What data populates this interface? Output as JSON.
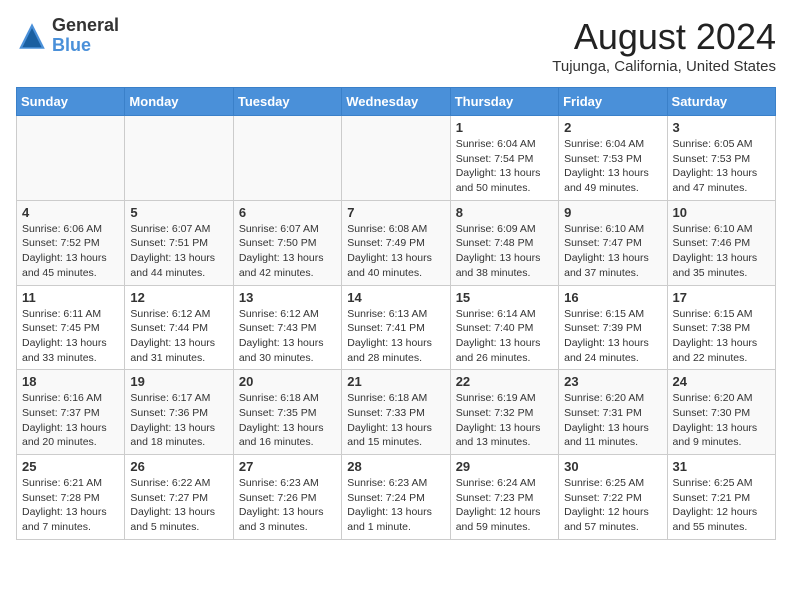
{
  "header": {
    "logo_general": "General",
    "logo_blue": "Blue",
    "month_title": "August 2024",
    "location": "Tujunga, California, United States"
  },
  "days_of_week": [
    "Sunday",
    "Monday",
    "Tuesday",
    "Wednesday",
    "Thursday",
    "Friday",
    "Saturday"
  ],
  "weeks": [
    [
      {
        "day": "",
        "info": ""
      },
      {
        "day": "",
        "info": ""
      },
      {
        "day": "",
        "info": ""
      },
      {
        "day": "",
        "info": ""
      },
      {
        "day": "1",
        "info": "Sunrise: 6:04 AM\nSunset: 7:54 PM\nDaylight: 13 hours\nand 50 minutes."
      },
      {
        "day": "2",
        "info": "Sunrise: 6:04 AM\nSunset: 7:53 PM\nDaylight: 13 hours\nand 49 minutes."
      },
      {
        "day": "3",
        "info": "Sunrise: 6:05 AM\nSunset: 7:53 PM\nDaylight: 13 hours\nand 47 minutes."
      }
    ],
    [
      {
        "day": "4",
        "info": "Sunrise: 6:06 AM\nSunset: 7:52 PM\nDaylight: 13 hours\nand 45 minutes."
      },
      {
        "day": "5",
        "info": "Sunrise: 6:07 AM\nSunset: 7:51 PM\nDaylight: 13 hours\nand 44 minutes."
      },
      {
        "day": "6",
        "info": "Sunrise: 6:07 AM\nSunset: 7:50 PM\nDaylight: 13 hours\nand 42 minutes."
      },
      {
        "day": "7",
        "info": "Sunrise: 6:08 AM\nSunset: 7:49 PM\nDaylight: 13 hours\nand 40 minutes."
      },
      {
        "day": "8",
        "info": "Sunrise: 6:09 AM\nSunset: 7:48 PM\nDaylight: 13 hours\nand 38 minutes."
      },
      {
        "day": "9",
        "info": "Sunrise: 6:10 AM\nSunset: 7:47 PM\nDaylight: 13 hours\nand 37 minutes."
      },
      {
        "day": "10",
        "info": "Sunrise: 6:10 AM\nSunset: 7:46 PM\nDaylight: 13 hours\nand 35 minutes."
      }
    ],
    [
      {
        "day": "11",
        "info": "Sunrise: 6:11 AM\nSunset: 7:45 PM\nDaylight: 13 hours\nand 33 minutes."
      },
      {
        "day": "12",
        "info": "Sunrise: 6:12 AM\nSunset: 7:44 PM\nDaylight: 13 hours\nand 31 minutes."
      },
      {
        "day": "13",
        "info": "Sunrise: 6:12 AM\nSunset: 7:43 PM\nDaylight: 13 hours\nand 30 minutes."
      },
      {
        "day": "14",
        "info": "Sunrise: 6:13 AM\nSunset: 7:41 PM\nDaylight: 13 hours\nand 28 minutes."
      },
      {
        "day": "15",
        "info": "Sunrise: 6:14 AM\nSunset: 7:40 PM\nDaylight: 13 hours\nand 26 minutes."
      },
      {
        "day": "16",
        "info": "Sunrise: 6:15 AM\nSunset: 7:39 PM\nDaylight: 13 hours\nand 24 minutes."
      },
      {
        "day": "17",
        "info": "Sunrise: 6:15 AM\nSunset: 7:38 PM\nDaylight: 13 hours\nand 22 minutes."
      }
    ],
    [
      {
        "day": "18",
        "info": "Sunrise: 6:16 AM\nSunset: 7:37 PM\nDaylight: 13 hours\nand 20 minutes."
      },
      {
        "day": "19",
        "info": "Sunrise: 6:17 AM\nSunset: 7:36 PM\nDaylight: 13 hours\nand 18 minutes."
      },
      {
        "day": "20",
        "info": "Sunrise: 6:18 AM\nSunset: 7:35 PM\nDaylight: 13 hours\nand 16 minutes."
      },
      {
        "day": "21",
        "info": "Sunrise: 6:18 AM\nSunset: 7:33 PM\nDaylight: 13 hours\nand 15 minutes."
      },
      {
        "day": "22",
        "info": "Sunrise: 6:19 AM\nSunset: 7:32 PM\nDaylight: 13 hours\nand 13 minutes."
      },
      {
        "day": "23",
        "info": "Sunrise: 6:20 AM\nSunset: 7:31 PM\nDaylight: 13 hours\nand 11 minutes."
      },
      {
        "day": "24",
        "info": "Sunrise: 6:20 AM\nSunset: 7:30 PM\nDaylight: 13 hours\nand 9 minutes."
      }
    ],
    [
      {
        "day": "25",
        "info": "Sunrise: 6:21 AM\nSunset: 7:28 PM\nDaylight: 13 hours\nand 7 minutes."
      },
      {
        "day": "26",
        "info": "Sunrise: 6:22 AM\nSunset: 7:27 PM\nDaylight: 13 hours\nand 5 minutes."
      },
      {
        "day": "27",
        "info": "Sunrise: 6:23 AM\nSunset: 7:26 PM\nDaylight: 13 hours\nand 3 minutes."
      },
      {
        "day": "28",
        "info": "Sunrise: 6:23 AM\nSunset: 7:24 PM\nDaylight: 13 hours\nand 1 minute."
      },
      {
        "day": "29",
        "info": "Sunrise: 6:24 AM\nSunset: 7:23 PM\nDaylight: 12 hours\nand 59 minutes."
      },
      {
        "day": "30",
        "info": "Sunrise: 6:25 AM\nSunset: 7:22 PM\nDaylight: 12 hours\nand 57 minutes."
      },
      {
        "day": "31",
        "info": "Sunrise: 6:25 AM\nSunset: 7:21 PM\nDaylight: 12 hours\nand 55 minutes."
      }
    ]
  ]
}
